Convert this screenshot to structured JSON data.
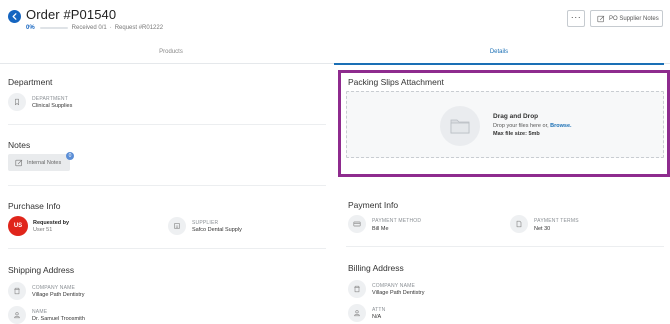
{
  "header": {
    "title": "Order #P01540",
    "progress_label": "0%",
    "progress_fraction": 0.0,
    "received_text": "Received 0/1",
    "separator": "·",
    "request_text": "Request #R01222",
    "more_label": "···",
    "supplier_notes_label": "PO Supplier Notes"
  },
  "tabs": [
    {
      "label": "Products",
      "active": false
    },
    {
      "label": "Details",
      "active": true
    }
  ],
  "department": {
    "title": "Department",
    "field_label": "Department",
    "field_value": "Clinical Supplies"
  },
  "notes": {
    "title": "Notes",
    "internal_notes_label": "Internal Notes",
    "badge_count": "0"
  },
  "purchase_info": {
    "title": "Purchase Info",
    "avatar_initials": "US",
    "requested_by_label": "Requested by",
    "requested_by_value": "User 51",
    "supplier_label": "Supplier",
    "supplier_value": "Safco Dental Supply"
  },
  "shipping_address": {
    "title": "Shipping Address",
    "company_label": "Company Name",
    "company_value": "Village Path Dentistry",
    "name_label": "Name",
    "name_value": "Dr. Samuel Troosmith"
  },
  "packing_slips": {
    "title": "Packing Slips Attachment",
    "drag_title": "Drag and Drop",
    "drop_text": "Drop your files here or,",
    "browse_label": "Browse.",
    "max_size": "Max file size: 5mb"
  },
  "payment_info": {
    "title": "Payment Info",
    "method_label": "Payment Method",
    "method_value": "Bill Me",
    "terms_label": "Payment Terms",
    "terms_value": "Net 30"
  },
  "billing_address": {
    "title": "Billing Address",
    "company_label": "Company Name",
    "company_value": "Village Path Dentistry",
    "attn_label": "Attn",
    "attn_value": "N/A"
  },
  "colors": {
    "accent": "#1565c0",
    "highlight": "#8e2b8e",
    "avatar": "#e0251b"
  },
  "icons": {
    "back": "arrow-left-icon",
    "notes": "pencil-note-icon",
    "department": "bookmark-icon",
    "supplier": "storefront-icon",
    "company": "building-icon",
    "person": "user-icon",
    "card": "credit-card-icon",
    "document": "document-icon",
    "folder": "folder-icon"
  }
}
